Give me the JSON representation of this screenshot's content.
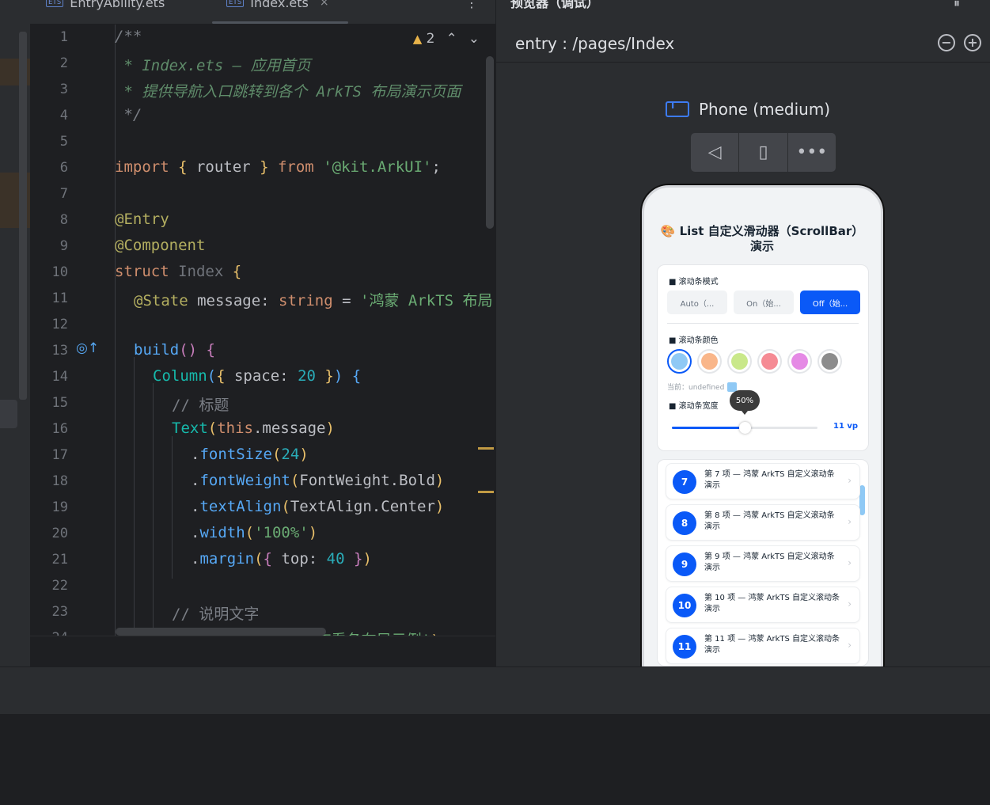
{
  "tabs": [
    {
      "badge": "ETS",
      "label": "EntryAbility.ets"
    },
    {
      "badge": "ETS",
      "label": "Index.ets",
      "close": "×"
    }
  ],
  "tab_more": "⋮",
  "editor": {
    "warnings": "2",
    "line_numbers": [
      "1",
      "2",
      "3",
      "4",
      "5",
      "6",
      "7",
      "8",
      "9",
      "10",
      "11",
      "12",
      "13",
      "14",
      "15",
      "16",
      "17",
      "18",
      "19",
      "20",
      "21",
      "22",
      "23",
      "24"
    ]
  },
  "preview": {
    "title": "预览器（调试）",
    "pause": "⏸",
    "path": "entry : /pages/Index",
    "zoom_out": "−",
    "zoom_in": "+",
    "device": "Phone (medium)",
    "toolbar": {
      "back": "◁",
      "rotate": "▯",
      "more": "•••"
    }
  },
  "app": {
    "title": "🎨 List 自定义滑动器（ScrollBar）演示",
    "mode_label": "滚动条模式",
    "modes": [
      "Auto（...",
      "On（始...",
      "Off（始..."
    ],
    "active_mode": 2,
    "color_label": "滚动条颜色",
    "colors": [
      "#8fc9f5",
      "#f9b68a",
      "#c9e88a",
      "#f58b94",
      "#e58ae5",
      "#8c8c8c"
    ],
    "current_color_text": "当前：undefined",
    "width_label": "滚动条宽度",
    "tooltip": "50%",
    "slider_fraction": 0.5,
    "width_value": "11 vp",
    "items": [
      {
        "num": "7",
        "text": "第 7 项 — 鸿蒙 ArkTS 自定义滚动条演示"
      },
      {
        "num": "8",
        "text": "第 8 项 — 鸿蒙 ArkTS 自定义滚动条演示"
      },
      {
        "num": "9",
        "text": "第 9 项 — 鸿蒙 ArkTS 自定义滚动条演示"
      },
      {
        "num": "10",
        "text": "第 10 项 — 鸿蒙 ArkTS 自定义滚动条演示"
      },
      {
        "num": "11",
        "text": "第 11 项 — 鸿蒙 ArkTS 自定义滚动条演示"
      }
    ],
    "chevron": "›"
  },
  "colors": {
    "accent": "#0a59f7",
    "editor_bg": "#1e1f22",
    "panel_bg": "#2b2d30"
  }
}
